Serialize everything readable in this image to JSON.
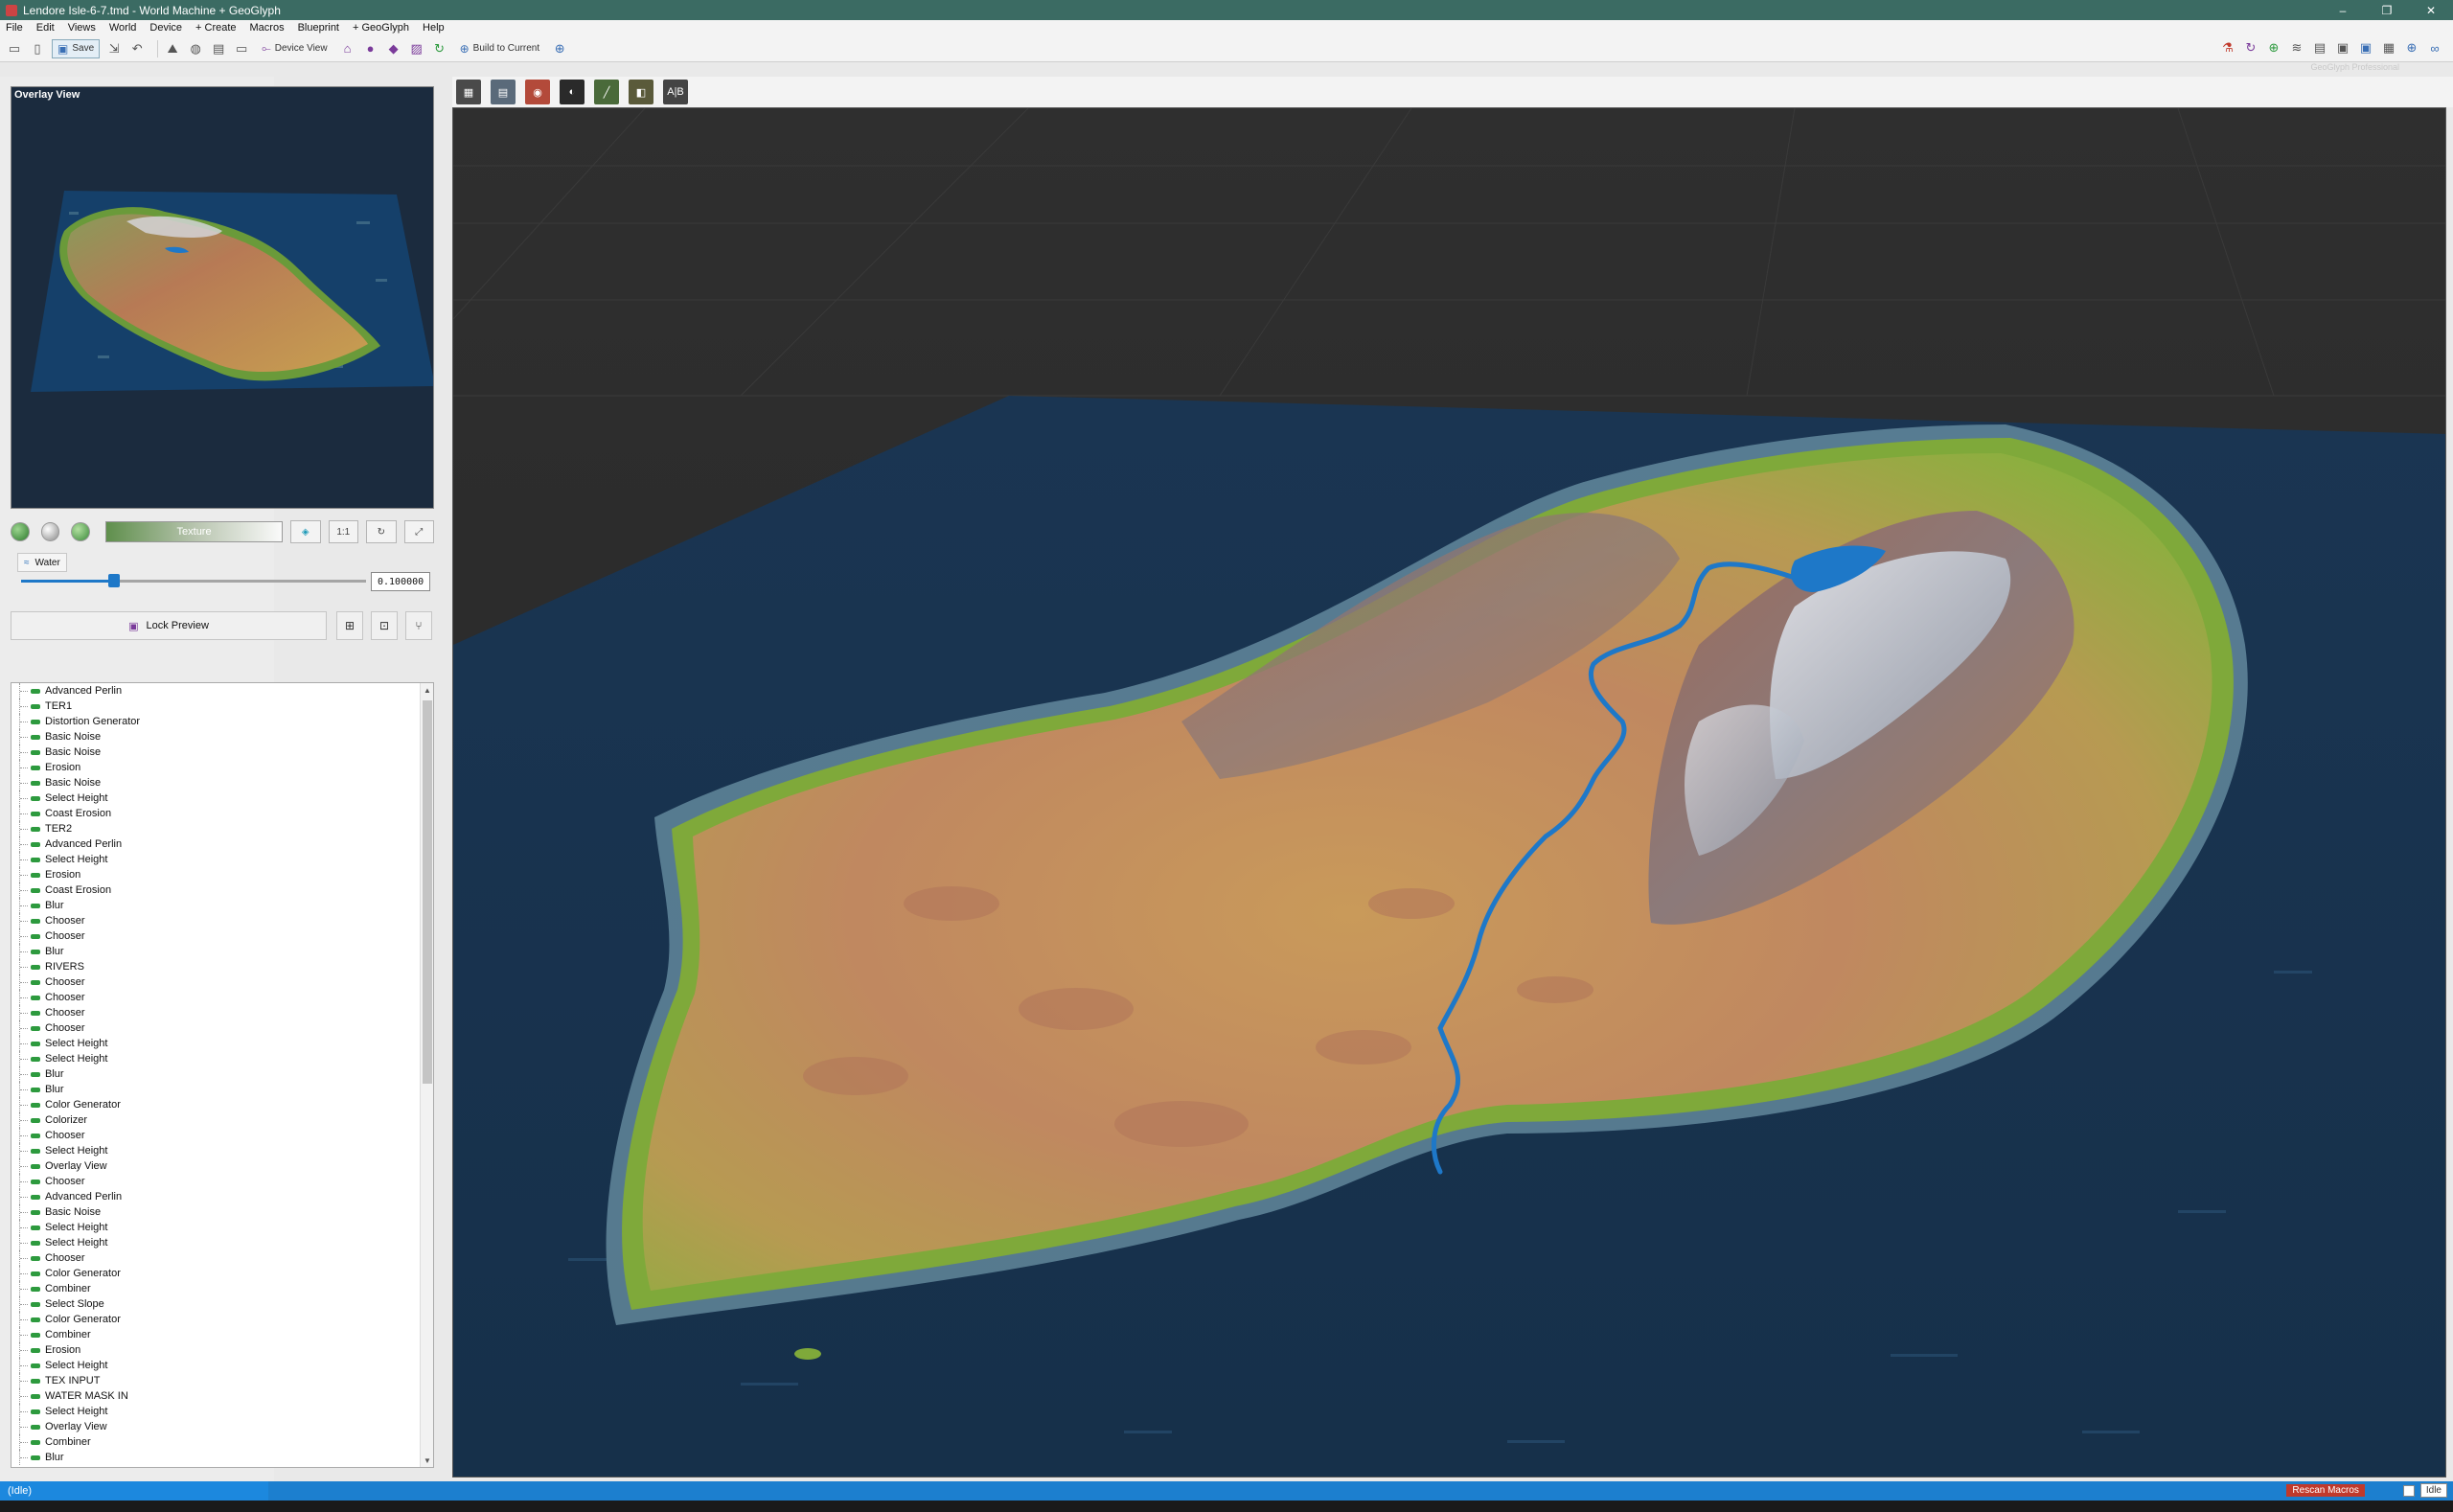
{
  "window": {
    "title": "Lendore Isle-6-7.tmd - World Machine + GeoGlyph",
    "controls": [
      "–",
      "❐",
      "✕"
    ]
  },
  "menu": [
    "File",
    "Edit",
    "Views",
    "World",
    "Device",
    "+ Create",
    "Macros",
    "Blueprint",
    "+ GeoGlyph",
    "Help"
  ],
  "toolbar": {
    "save_label": "Save",
    "device_view_label": "Device View",
    "build_label": "Build to Current",
    "edition": "GeoGlyph Professional"
  },
  "overlay": {
    "label": "Overlay View"
  },
  "preview": {
    "texture_label": "Texture",
    "ratio_label": "1:1"
  },
  "water": {
    "label": "Water",
    "value": "0.100000",
    "level": 0.27
  },
  "lock": {
    "label": "Lock Preview"
  },
  "viewport_toolbar": {
    "ab_label": "A|B"
  },
  "nodes": [
    "Advanced Perlin",
    "TER1",
    "Distortion Generator",
    "Basic Noise",
    "Basic Noise",
    "Erosion",
    "Basic Noise",
    "Select Height",
    "Coast Erosion",
    "TER2",
    "Advanced Perlin",
    "Select Height",
    "Erosion",
    "Coast Erosion",
    "Blur",
    "Chooser",
    "Chooser",
    "Blur",
    "RIVERS",
    "Chooser",
    "Chooser",
    "Chooser",
    "Chooser",
    "Select Height",
    "Select Height",
    "Blur",
    "Blur",
    "Color Generator",
    "Colorizer",
    "Chooser",
    "Select Height",
    "Overlay View",
    "Chooser",
    "Advanced Perlin",
    "Basic Noise",
    "Select Height",
    "Select Height",
    "Chooser",
    "Color Generator",
    "Combiner",
    "Select Slope",
    "Color Generator",
    "Combiner",
    "Erosion",
    "Select Height",
    "TEX INPUT",
    "WATER MASK IN",
    "Select Height",
    "Overlay View",
    "Combiner",
    "Blur"
  ],
  "status": {
    "left": "(Idle)",
    "rescan_label": "Rescan Macros",
    "right_label": "Idle"
  },
  "colors": {
    "titlebar": "#3b6b63",
    "statusbar": "#1c7fcf",
    "water": "#1e78c8",
    "node_dot": "#2d9a3e"
  }
}
